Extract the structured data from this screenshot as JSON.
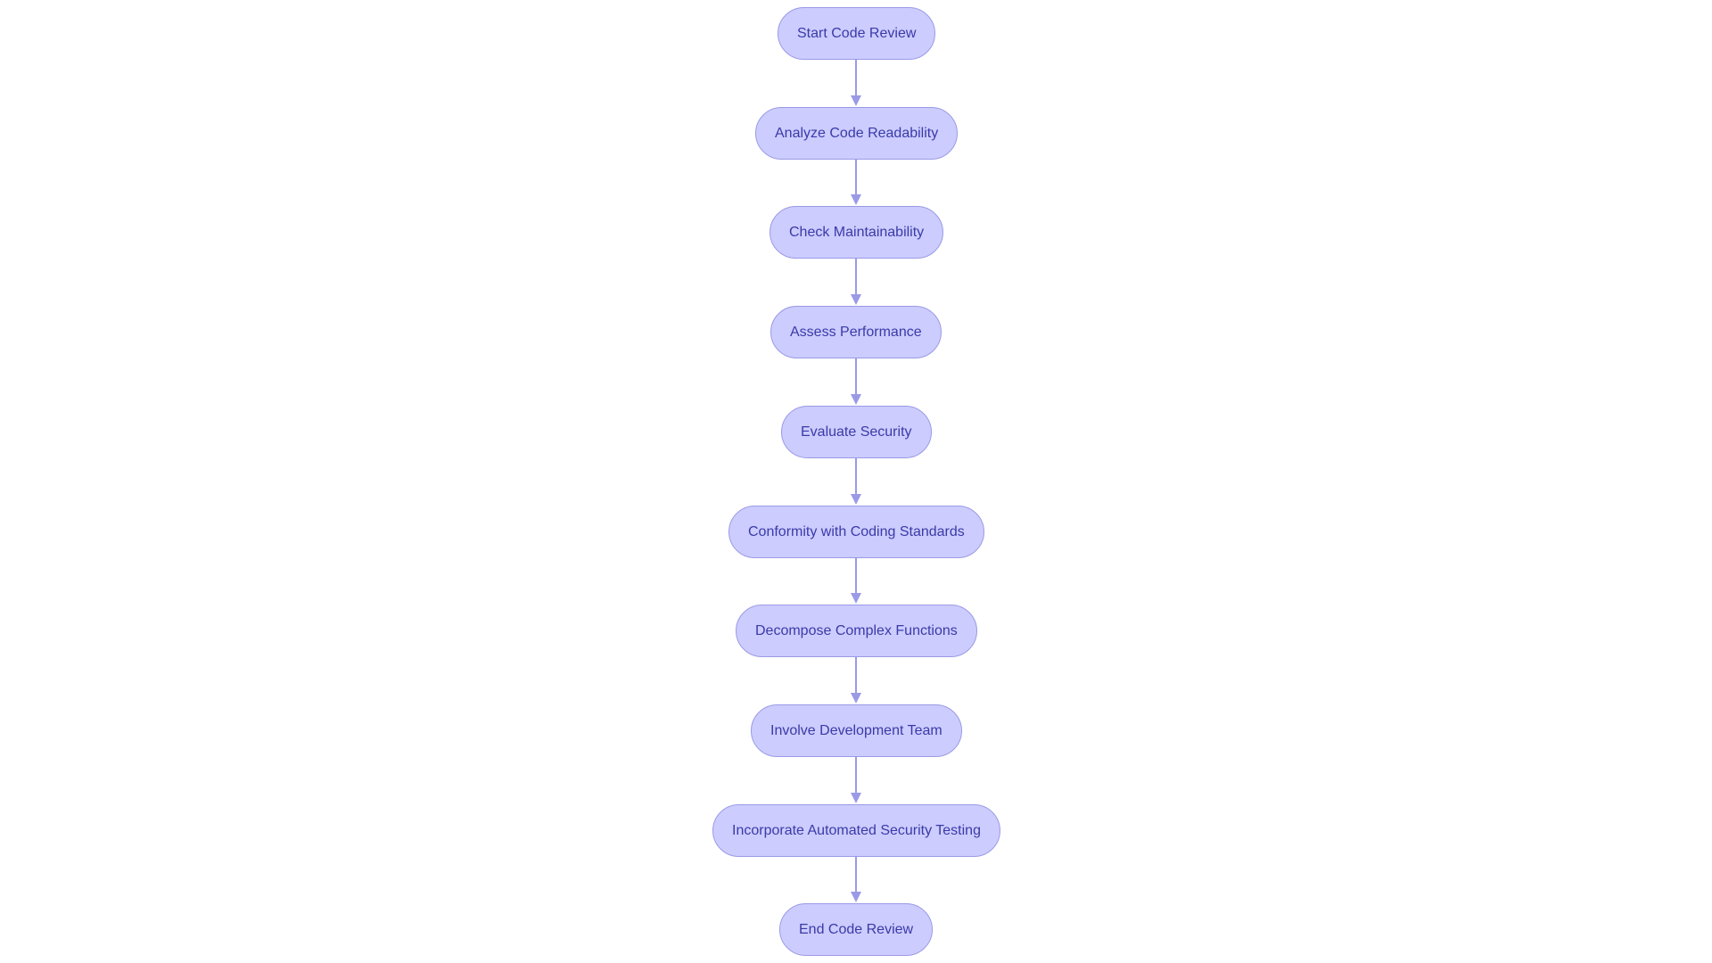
{
  "chart_data": {
    "type": "flowchart",
    "direction": "top-down",
    "nodes": [
      {
        "id": "A",
        "label": "Start Code Review",
        "shape": "stadium"
      },
      {
        "id": "B",
        "label": "Analyze Code Readability",
        "shape": "stadium"
      },
      {
        "id": "C",
        "label": "Check Maintainability",
        "shape": "stadium"
      },
      {
        "id": "D",
        "label": "Assess Performance",
        "shape": "stadium"
      },
      {
        "id": "E",
        "label": "Evaluate Security",
        "shape": "stadium"
      },
      {
        "id": "F",
        "label": "Conformity with Coding Standards",
        "shape": "stadium"
      },
      {
        "id": "G",
        "label": "Decompose Complex Functions",
        "shape": "stadium"
      },
      {
        "id": "H",
        "label": "Involve Development Team",
        "shape": "stadium"
      },
      {
        "id": "I",
        "label": "Incorporate Automated Security Testing",
        "shape": "stadium"
      },
      {
        "id": "J",
        "label": "End Code Review",
        "shape": "stadium"
      }
    ],
    "edges": [
      {
        "from": "A",
        "to": "B"
      },
      {
        "from": "B",
        "to": "C"
      },
      {
        "from": "C",
        "to": "D"
      },
      {
        "from": "D",
        "to": "E"
      },
      {
        "from": "E",
        "to": "F"
      },
      {
        "from": "F",
        "to": "G"
      },
      {
        "from": "G",
        "to": "H"
      },
      {
        "from": "H",
        "to": "I"
      },
      {
        "from": "I",
        "to": "J"
      }
    ],
    "colors": {
      "node_fill": "#ccccff",
      "node_stroke": "#9a9ae6",
      "node_text": "#3a3aa8",
      "edge": "#9a9ae6"
    }
  }
}
